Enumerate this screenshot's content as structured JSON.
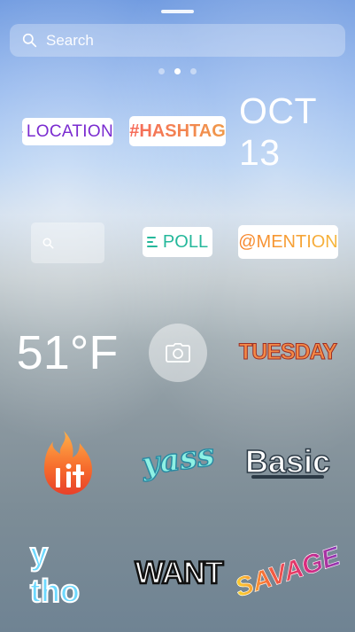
{
  "search": {
    "placeholder": "Search"
  },
  "pager": {
    "count": 3,
    "active_index": 1
  },
  "stickers": {
    "location": {
      "label": "LOCATION",
      "icon": "location-pin-icon"
    },
    "hashtag": {
      "label": "#HASHTAG"
    },
    "date": {
      "label": "OCT 13"
    },
    "poll": {
      "label": "POLL",
      "icon": "poll-bars-icon"
    },
    "mention": {
      "label": "@MENTION"
    },
    "temperature": {
      "label": "51°F"
    },
    "camera": {
      "icon": "camera-icon"
    },
    "day": {
      "label": "TUESDAY"
    },
    "lit": {
      "label": "lit",
      "icon": "flame-icon"
    },
    "yass": {
      "label": "yass"
    },
    "basic": {
      "label": "Basic"
    },
    "ytho": {
      "label": "y tho"
    },
    "want": {
      "label": "WANT"
    },
    "savage": {
      "label": "SAVAGE"
    }
  },
  "colors": {
    "location": "#7a2bd0",
    "poll": "#25b89b",
    "hashtag_start": "#f66a5a",
    "mention_start": "#f7842c"
  }
}
